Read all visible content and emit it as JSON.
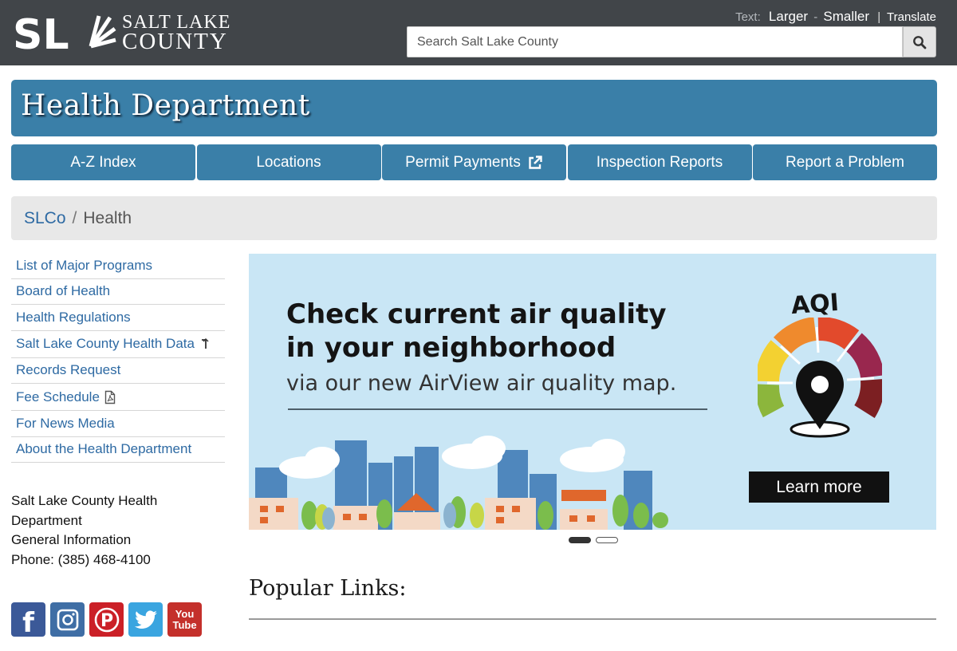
{
  "header": {
    "logo_mark": "SL",
    "logo_line1": "SALT LAKE",
    "logo_line2": "COUNTY",
    "text_label": "Text:",
    "larger": "Larger",
    "smaller": "Smaller",
    "translate": "Translate",
    "search_placeholder": "Search Salt Lake County",
    "search_icon": "magnifier-icon"
  },
  "department": {
    "title": "Health Department"
  },
  "nav": [
    {
      "label": "A-Z Index"
    },
    {
      "label": "Locations"
    },
    {
      "label": "Permit Payments",
      "icon": "external-link-icon"
    },
    {
      "label": "Inspection Reports"
    },
    {
      "label": "Report a Problem"
    }
  ],
  "breadcrumb": {
    "root": "SLCo",
    "separator": "/",
    "current": "Health"
  },
  "sidebar": [
    {
      "label": "List of Major Programs"
    },
    {
      "label": "Board of Health"
    },
    {
      "label": "Health Regulations"
    },
    {
      "label": "Salt Lake County Health Data",
      "icon": "arrow-up-icon"
    },
    {
      "label": "Records Request"
    },
    {
      "label": "Fee Schedule",
      "icon": "pdf-icon"
    },
    {
      "label": "For News Media"
    },
    {
      "label": "About the Health Department"
    }
  ],
  "contact": {
    "line1": "Salt Lake County Health",
    "line2": "Department",
    "line3": "General Information",
    "line4": "Phone: (385) 468-4100"
  },
  "social": [
    {
      "icon": "facebook-icon",
      "glyph": "f",
      "color": "#3b5998"
    },
    {
      "icon": "instagram-icon",
      "glyph": "",
      "color": "#3f6ea5"
    },
    {
      "icon": "pinterest-icon",
      "glyph": "P",
      "color": "#cb2027"
    },
    {
      "icon": "twitter-icon",
      "glyph": "",
      "color": "#3aa5e0"
    },
    {
      "icon": "youtube-icon",
      "glyph": "You Tube",
      "color": "#c4302b"
    }
  ],
  "promo": {
    "headline1": "Check current air quality",
    "headline2": "in your neighborhood",
    "subhead": "via our new AirView air quality map.",
    "aqi": "AQI",
    "cta": "Learn more"
  },
  "carousel": {
    "slides": 2,
    "active": 1
  },
  "popular": {
    "title": "Popular Links:"
  },
  "colors": {
    "brand_blue": "#3a7fa8",
    "topbar": "#414549",
    "link": "#2e6aa3"
  }
}
